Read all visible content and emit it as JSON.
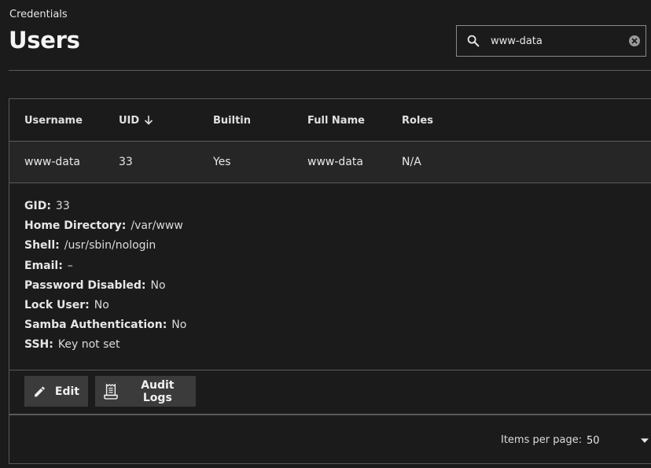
{
  "header": {
    "breadcrumb": "Credentials",
    "title": "Users"
  },
  "search": {
    "value": "www-data",
    "placeholder": "Search"
  },
  "table": {
    "columns": [
      {
        "label": "Username"
      },
      {
        "label": "UID",
        "sort": "descending",
        "sort_icon": "arrow-down-icon"
      },
      {
        "label": "Builtin"
      },
      {
        "label": "Full Name"
      },
      {
        "label": "Roles"
      }
    ],
    "row": {
      "username": "www-data",
      "uid": "33",
      "builtin": "Yes",
      "full_name": "www-data",
      "roles": "N/A"
    }
  },
  "details": [
    {
      "label": "GID:",
      "value": "33"
    },
    {
      "label": "Home Directory:",
      "value": "/var/www"
    },
    {
      "label": "Shell:",
      "value": "/usr/sbin/nologin"
    },
    {
      "label": "Email:",
      "value": "–"
    },
    {
      "label": "Password Disabled:",
      "value": "No"
    },
    {
      "label": "Lock User:",
      "value": "No"
    },
    {
      "label": "Samba Authentication:",
      "value": "No"
    },
    {
      "label": "SSH:",
      "value": "Key not set"
    }
  ],
  "actions": {
    "edit_label": "Edit",
    "edit_icon": "pencil-icon",
    "audit_label": "Audit Logs",
    "audit_icon": "receipt-icon"
  },
  "pagination": {
    "items_per_page_label": "Items per page:",
    "items_per_page_value": "50"
  },
  "colors": {
    "background": "#1b1b1b",
    "row_highlight": "#262626",
    "button_bg": "#3b3b3b",
    "border": "#5a5a5a"
  }
}
